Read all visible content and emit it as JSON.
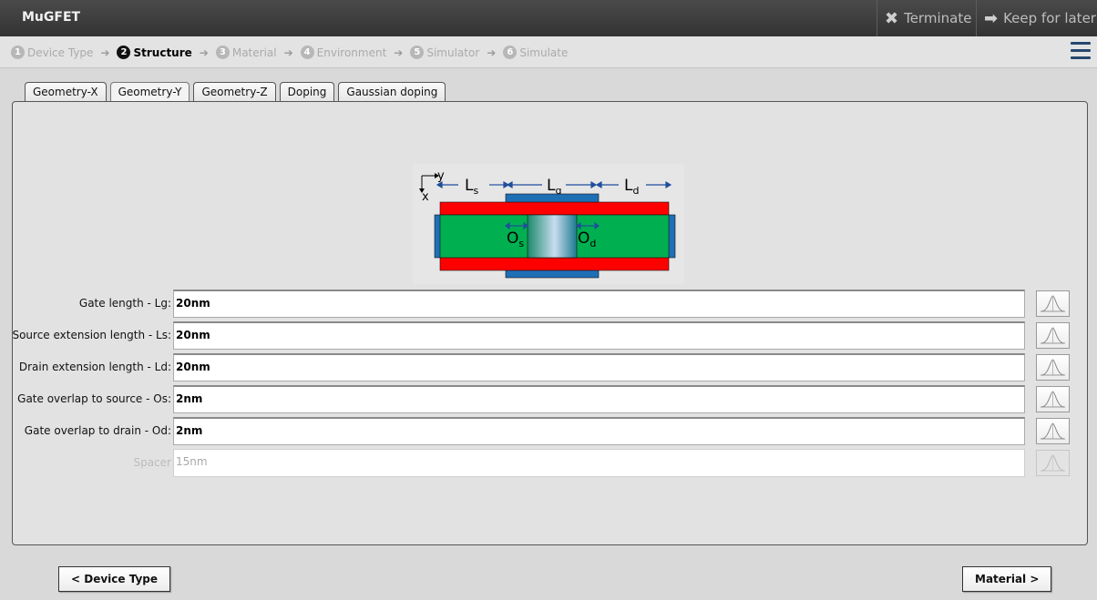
{
  "app": {
    "title": "MuGFET",
    "terminate_label": "Terminate",
    "keep_label": "Keep for later"
  },
  "steps": [
    {
      "num": "1",
      "label": "Device Type",
      "active": false
    },
    {
      "num": "2",
      "label": "Structure",
      "active": true
    },
    {
      "num": "3",
      "label": "Material",
      "active": false
    },
    {
      "num": "4",
      "label": "Environment",
      "active": false
    },
    {
      "num": "5",
      "label": "Simulator",
      "active": false
    },
    {
      "num": "6",
      "label": "Simulate",
      "active": false
    }
  ],
  "tabs": [
    {
      "label": "Geometry-X",
      "active": false
    },
    {
      "label": "Geometry-Y",
      "active": true
    },
    {
      "label": "Geometry-Z",
      "active": false
    },
    {
      "label": "Doping",
      "active": false
    },
    {
      "label": "Gaussian doping",
      "active": false
    }
  ],
  "diagram": {
    "axis_y": "y",
    "axis_x": "x",
    "Ls": "L",
    "Ls_sub": "s",
    "Lg": "L",
    "Lg_sub": "g",
    "Ld": "L",
    "Ld_sub": "d",
    "Os": "O",
    "Os_sub": "s",
    "Od": "O",
    "Od_sub": "d"
  },
  "fields": [
    {
      "label": "Gate length - Lg:",
      "value": "20nm",
      "disabled": false
    },
    {
      "label": "Source extension length - Ls:",
      "value": "20nm",
      "disabled": false
    },
    {
      "label": "Drain extension length - Ld:",
      "value": "20nm",
      "disabled": false
    },
    {
      "label": "Gate overlap to source - Os:",
      "value": "2nm",
      "disabled": false
    },
    {
      "label": "Gate overlap to drain - Od:",
      "value": "2nm",
      "disabled": false
    },
    {
      "label": "Spacer",
      "value": "15nm",
      "disabled": true
    }
  ],
  "nav": {
    "prev_label": "< Device Type",
    "next_label": "Material >"
  },
  "colors": {
    "titlebar": "#3a3a3a",
    "accent": "#26476e",
    "oxide": "#ff0000",
    "silicon": "#00b050",
    "gate": "#1f6fb5"
  }
}
